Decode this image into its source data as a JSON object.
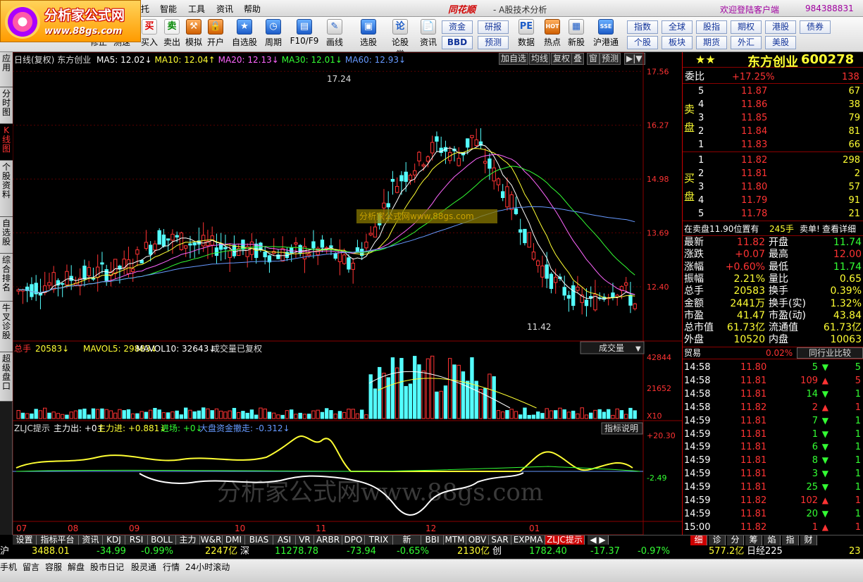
{
  "logo": {
    "name": "分析家公式网",
    "url": "www.88gs.com"
  },
  "menu": {
    "items": [
      "托",
      "智能",
      "工具",
      "资讯",
      "帮助"
    ],
    "brand": "同花顺",
    "brand_sub": "- A股技术分析",
    "welcome": "欢迎登陆客户端",
    "account": "984388831"
  },
  "toolbar": {
    "buttons": [
      {
        "label": "修正",
        "icon": "undo-icon"
      },
      {
        "label": "测速",
        "icon": "speed-icon"
      },
      {
        "label": "买入",
        "icon": "buy-icon",
        "glyph": "买"
      },
      {
        "label": "卖出",
        "icon": "sell-icon",
        "glyph": "卖"
      },
      {
        "label": "模拟",
        "icon": "hammer-icon",
        "glyph": "⚒"
      },
      {
        "label": "开户",
        "icon": "lock-icon",
        "glyph": "🔒"
      },
      {
        "label": "自选股",
        "icon": "star-icon",
        "glyph": "★"
      },
      {
        "label": "周期",
        "icon": "clock-icon",
        "glyph": "◷"
      },
      {
        "label": "F10/F9",
        "icon": "f10-icon",
        "glyph": "▤"
      },
      {
        "label": "画线",
        "icon": "pen-icon",
        "glyph": "✎"
      },
      {
        "label": "选股",
        "icon": "select-icon",
        "glyph": "▣"
      },
      {
        "label": "论股堂",
        "icon": "forum-icon",
        "glyph": "论"
      },
      {
        "label": "资讯",
        "icon": "news-icon",
        "glyph": "📄"
      },
      {
        "label": "数据",
        "icon": "pe-icon",
        "glyph": "PE"
      },
      {
        "label": "热点",
        "icon": "hot-icon",
        "glyph": "HOT"
      },
      {
        "label": "新股",
        "icon": "ipo-icon",
        "glyph": "▦"
      },
      {
        "label": "沪港通",
        "icon": "hk-icon",
        "glyph": "SSE"
      }
    ],
    "small": [
      [
        "资金",
        "研报"
      ],
      [
        "BBD",
        "预测"
      ]
    ],
    "right": [
      [
        "指数",
        "全球",
        "股指",
        "期权",
        "港股",
        "债券"
      ],
      [
        "个股",
        "板块",
        "期货",
        "外汇",
        "美股"
      ]
    ]
  },
  "lefttabs": [
    "应用",
    "分时图",
    "K线图",
    "个股资料",
    "自选股",
    "综合排名",
    "牛叉诊股",
    "超级盘口"
  ],
  "kline": {
    "title": "日线(复权)",
    "stock": "东方创业",
    "ma": [
      {
        "name": "MA5",
        "val": "12.02↓",
        "color": "#ffffff"
      },
      {
        "name": "MA10",
        "val": "12.04↑",
        "color": "#ffff33"
      },
      {
        "name": "MA20",
        "val": "12.13↓",
        "color": "#ff66ff"
      },
      {
        "name": "MA30",
        "val": "12.01↓",
        "color": "#33ff33"
      },
      {
        "name": "MA60",
        "val": "12.93↓",
        "color": "#6699ff"
      }
    ],
    "buttons": [
      "加自选",
      "均线",
      "复权",
      "叠",
      "窗",
      "预测"
    ],
    "ylabels": [
      "17.56",
      "16.27",
      "14.98",
      "13.69",
      "12.40"
    ],
    "high": "17.24",
    "low": "11.42",
    "watermark": "分析家公式网www.88gs.com"
  },
  "vol": {
    "label": "总手",
    "val": "20583↓",
    "mavol5": "MAVOL5: 29883↓",
    "mavol10": "MAVOL10: 32643↓",
    "note": "成交量已复权",
    "select": "成交量",
    "ylabels": [
      "42844",
      "21652"
    ],
    "x10": "X10"
  },
  "zljc": {
    "name": "ZLJC提示",
    "fields": [
      "主力出: +0↑",
      "主力进: +0.881↓",
      "进场: +0↓",
      "大盘资金撤走: -0.312↓"
    ],
    "button": "指标说明",
    "ylabels": [
      "+20.30",
      "-2.49"
    ],
    "watermark": "分析家公式网www.88gs.com"
  },
  "xaxis": [
    "07",
    "08",
    "09",
    "10",
    "11",
    "12",
    "01"
  ],
  "bottom_tabs": [
    "设置",
    "指标平台",
    "资讯",
    "KDJ",
    "RSI",
    "BOLL",
    "主力",
    "W&R",
    "DMI",
    "BIAS",
    "ASI",
    "VR",
    "ARBR",
    "DPO",
    "TRIX",
    "新DMA",
    "BBI",
    "MTM",
    "OBV",
    "SAR",
    "EXPMA",
    "ZLJC提示"
  ],
  "quote": {
    "stars": "★★",
    "name": "东方创业",
    "code": "600278",
    "weibi": {
      "label": "委比",
      "pct": "+17.25%",
      "diff": "138"
    },
    "sell": [
      [
        "5",
        "11.87",
        "67"
      ],
      [
        "4",
        "11.86",
        "38"
      ],
      [
        "3",
        "11.85",
        "79"
      ],
      [
        "2",
        "11.84",
        "81"
      ],
      [
        "1",
        "11.83",
        "66"
      ]
    ],
    "buy": [
      [
        "1",
        "11.82",
        "298"
      ],
      [
        "2",
        "11.81",
        "2"
      ],
      [
        "3",
        "11.80",
        "57"
      ],
      [
        "4",
        "11.79",
        "91"
      ],
      [
        "5",
        "11.78",
        "21"
      ]
    ],
    "sell_label": "卖盘",
    "buy_label": "买盘",
    "notice": {
      "text": "在卖盘11.90位置有",
      "qty": "245手",
      "tail": "卖单!",
      "link": "查看详细"
    },
    "stats": [
      [
        "最新",
        "11.82",
        "开盘",
        "11.74"
      ],
      [
        "涨跌",
        "+0.07",
        "最高",
        "12.00"
      ],
      [
        "涨幅",
        "+0.60%",
        "最低",
        "11.74"
      ],
      [
        "振幅",
        "2.21%",
        "量比",
        "0.65"
      ],
      [
        "总手",
        "20583",
        "换手",
        "0.39%"
      ],
      [
        "金额",
        "2441万",
        "换手(实)",
        "1.32%"
      ],
      [
        "市盈",
        "41.47",
        "市盈(动)",
        "43.84"
      ],
      [
        "总市值",
        "61.73亿",
        "流通值",
        "61.73亿"
      ],
      [
        "外盘",
        "10520",
        "内盘",
        "10063"
      ]
    ],
    "trade_head": {
      "label": "贸易",
      "pct": "0.02%",
      "button": "同行业比较"
    },
    "ticks": [
      [
        "14:58",
        "11.80",
        "5",
        "down",
        "5"
      ],
      [
        "14:58",
        "11.81",
        "109",
        "up",
        "5"
      ],
      [
        "14:58",
        "11.81",
        "14",
        "down",
        "1"
      ],
      [
        "14:58",
        "11.82",
        "2",
        "up",
        "1"
      ],
      [
        "14:59",
        "11.81",
        "7",
        "down",
        "1"
      ],
      [
        "14:59",
        "11.81",
        "1",
        "down",
        "1"
      ],
      [
        "14:59",
        "11.81",
        "6",
        "down",
        "1"
      ],
      [
        "14:59",
        "11.81",
        "8",
        "down",
        "1"
      ],
      [
        "14:59",
        "11.81",
        "3",
        "down",
        "1"
      ],
      [
        "14:59",
        "11.81",
        "25",
        "down",
        "1"
      ],
      [
        "14:59",
        "11.82",
        "102",
        "up",
        "1"
      ],
      [
        "14:59",
        "11.81",
        "20",
        "down",
        "1"
      ],
      [
        "15:00",
        "11.82",
        "1",
        "up",
        "1"
      ]
    ],
    "tabs": [
      "细",
      "诊",
      "分",
      "筹",
      "焰",
      "指",
      "财"
    ]
  },
  "status": {
    "sh": "沪",
    "sh_idx": "3488.01",
    "sh_chg": "-34.99",
    "sh_pct": "-0.99%",
    "sh_amt": "2247亿",
    "sz": "深",
    "sz_idx": "11278.78",
    "sz_chg": "-73.94",
    "sz_pct": "-0.65%",
    "sz_amt": "2130亿",
    "cy": "创",
    "cy_idx": "1782.40",
    "cy_chg": "-17.37",
    "cy_pct": "-0.97%",
    "cy_amt": "577.2亿",
    "nk": "日经225",
    "nk_tail": "23"
  },
  "bottombar": [
    "手机",
    "留言",
    "容服",
    "解盘",
    "股市日记",
    "股灵通",
    "行情",
    "24小时滚动"
  ]
}
